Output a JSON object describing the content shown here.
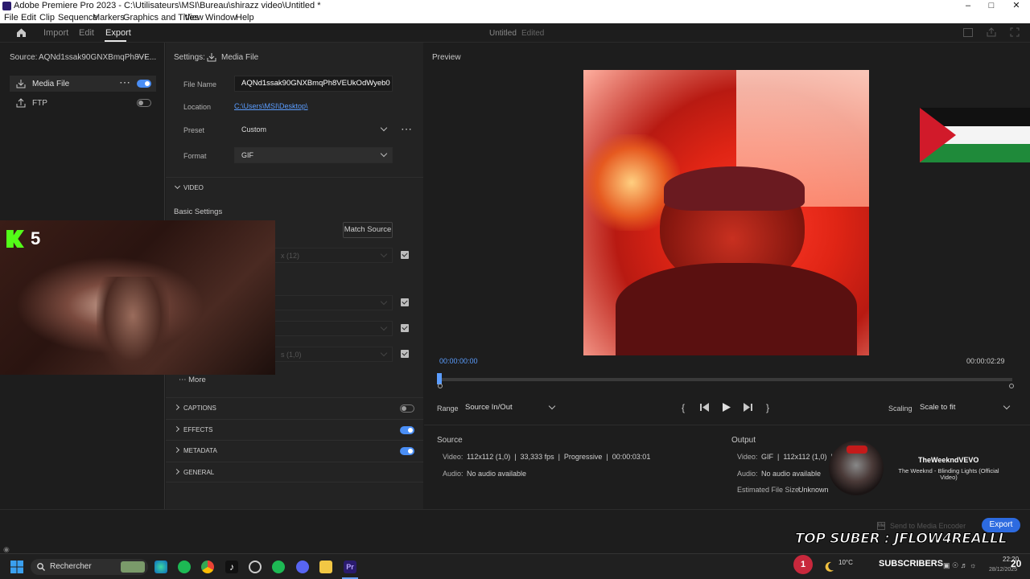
{
  "window": {
    "title": "Adobe Premiere Pro 2023 - C:\\Utilisateurs\\MSI\\Bureau\\shirazz video\\Untitled *"
  },
  "menu": [
    "File",
    "Edit",
    "Clip",
    "Sequence",
    "Markers",
    "Graphics and Titles",
    "View",
    "Window",
    "Help"
  ],
  "header": {
    "tabs": [
      "Import",
      "Edit",
      "Export"
    ],
    "project": "Untitled",
    "status": "Edited"
  },
  "left": {
    "source_label": "Source:",
    "source_value": "AQNd1ssak90GNXBmqPh8VE...",
    "destinations": [
      {
        "label": "Media File",
        "enabled": true
      },
      {
        "label": "FTP",
        "enabled": false
      }
    ]
  },
  "settings": {
    "label": "Settings:",
    "target": "Media File",
    "file_name_label": "File Name",
    "file_name": "AQNd1ssak90GNXBmqPh8VEUkOdWyeb0",
    "location_label": "Location",
    "location": "C:\\Users\\MSI\\Desktop\\",
    "preset_label": "Preset",
    "preset": "Custom",
    "format_label": "Format",
    "format": "GIF",
    "video_section": "VIDEO",
    "basic_settings": "Basic Settings",
    "match_source": "Match Source",
    "frame_size_partial": "x (12)",
    "rate_partial": "s (1,0)",
    "more": "More",
    "sections": [
      {
        "label": "CAPTIONS",
        "enabled": false
      },
      {
        "label": "EFFECTS",
        "enabled": true
      },
      {
        "label": "METADATA",
        "enabled": true
      },
      {
        "label": "GENERAL",
        "enabled": null
      }
    ]
  },
  "webcam": {
    "kick_label": "5"
  },
  "preview": {
    "title": "Preview",
    "timecode_start": "00:00:00:00",
    "timecode_end": "00:00:02:29",
    "range_label": "Range",
    "range_value": "Source In/Out",
    "scaling_label": "Scaling",
    "scaling_value": "Scale to fit"
  },
  "source_info": {
    "title": "Source",
    "video_label": "Video:",
    "video_value": "112x112 (1,0)  |  33,333 fps  |  Progressive  |  00:00:03:01",
    "audio_label": "Audio:",
    "audio_value": "No audio available"
  },
  "output_info": {
    "title": "Output",
    "video_label": "Video:",
    "video_value": "GIF  |  112x112 (1,0)  |  30",
    "audio_label": "Audio:",
    "audio_value": "No audio available",
    "size_label": "Estimated File Size:",
    "size_value": "Unknown"
  },
  "music": {
    "channel": "TheWeekndVEVO",
    "song": "The Weeknd - Blinding Lights (Official Video)"
  },
  "footer": {
    "send_to_encoder": "Send to Media Encoder",
    "export": "Export"
  },
  "overlay": {
    "top_suber": "TOP SUBER : JFLOW4REALLL",
    "subscribers": "SUBSCRIBERS",
    "sub_count": "1",
    "subs_number": "20"
  },
  "taskbar": {
    "search": "Rechercher",
    "weather": "10°C",
    "time": "22:20",
    "date": "28/12/2025"
  },
  "colors": {
    "accent": "#2d6be0",
    "toggle": "#4a8ef5",
    "link": "#5b9dff"
  }
}
